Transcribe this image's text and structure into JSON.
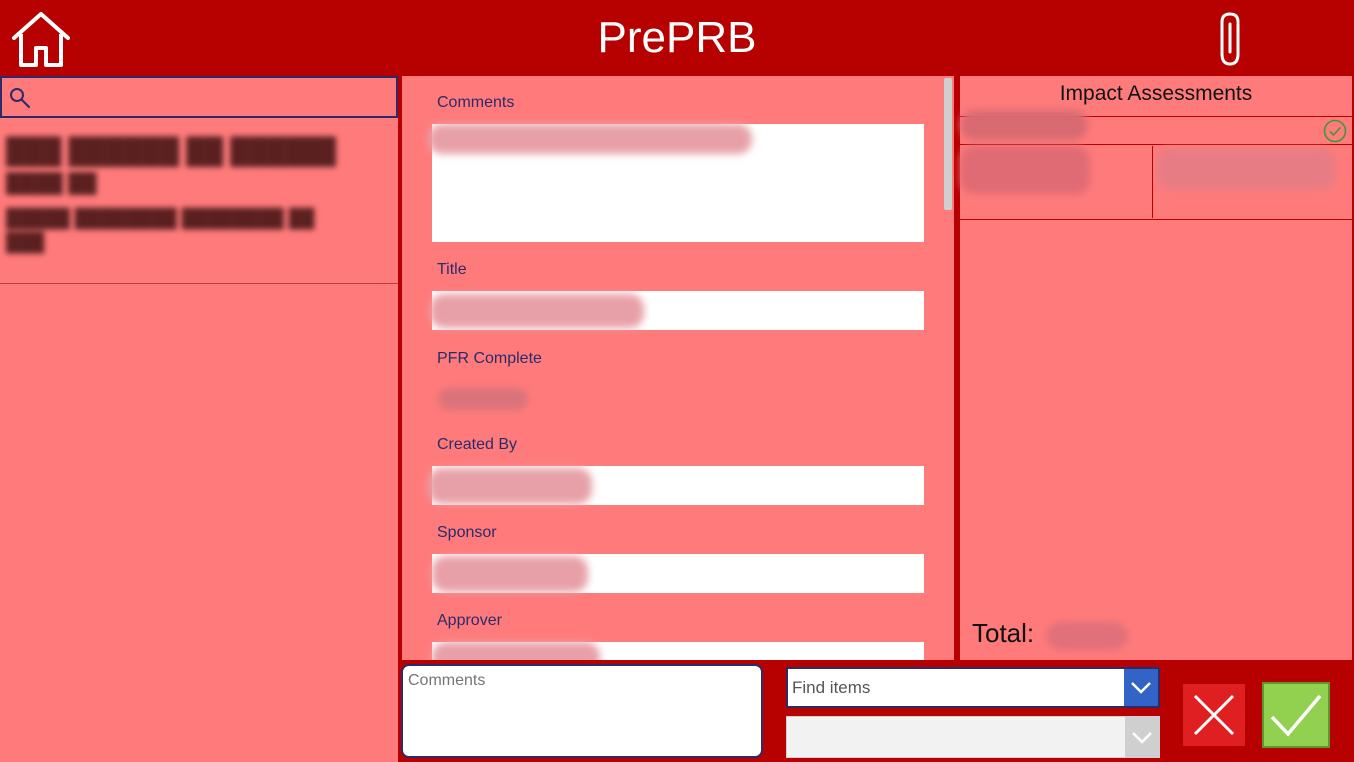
{
  "header": {
    "title": "PrePRB",
    "home_icon": "home-icon",
    "attach_icon": "paperclip-icon"
  },
  "colors": {
    "brand_red": "#b70000",
    "panel_pink": "#ff7b7b",
    "label_navy": "#2b2b6a",
    "approve_green": "#92d050",
    "cancel_red": "#e02020",
    "dropdown_blue": "#3264c8"
  },
  "left_panel": {
    "search_icon": "search-icon",
    "search": {
      "placeholder": "",
      "value": ""
    }
  },
  "form": {
    "fields": [
      {
        "label": "Comments"
      },
      {
        "label": "Title"
      },
      {
        "label": "PFR Complete"
      },
      {
        "label": "Created By"
      },
      {
        "label": "Sponsor"
      },
      {
        "label": "Approver"
      }
    ]
  },
  "impact": {
    "title": "Impact Assessments",
    "status_icon": "check-circle-icon",
    "total_label": "Total:"
  },
  "bottom": {
    "comments": {
      "placeholder": "Comments",
      "value": ""
    },
    "find_items": {
      "placeholder": "Find items"
    },
    "second_dropdown": {
      "value": ""
    },
    "cancel_icon": "close-icon",
    "approve_icon": "checkmark-icon"
  }
}
